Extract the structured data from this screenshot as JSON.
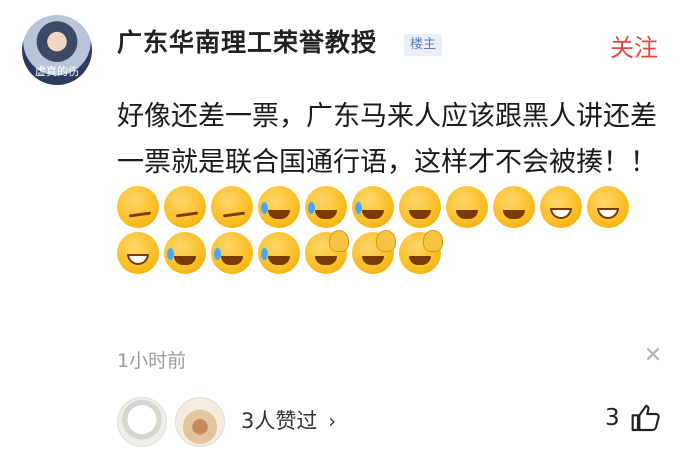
{
  "comment": {
    "avatar_caption": "虚真的伤",
    "username": "广东华南理工荣誉教授",
    "badge": "楼主",
    "follow_label": "关注",
    "text": "好像还差一票，广东马来人应该跟黑人讲还差一票就是联合国通行语，这样才不会被揍！！",
    "emojis": [
      "smirk",
      "smirk",
      "smirk",
      "cry",
      "cry",
      "cry",
      "laugh",
      "laugh",
      "laugh",
      "grin",
      "grin",
      "grin",
      "cry",
      "cry",
      "cry",
      "slap",
      "slap",
      "slap"
    ],
    "time": "1小时前",
    "likes_text": "3人赞过",
    "like_count": "3"
  },
  "icons": {
    "close": "close-icon",
    "chevron": "chevron-right-icon",
    "thumb": "thumbs-up-icon"
  },
  "colors": {
    "follow": "#e8463c",
    "badge_text": "#5a7fb8",
    "badge_bg": "#e9eef7",
    "muted": "#9b9b9b"
  }
}
